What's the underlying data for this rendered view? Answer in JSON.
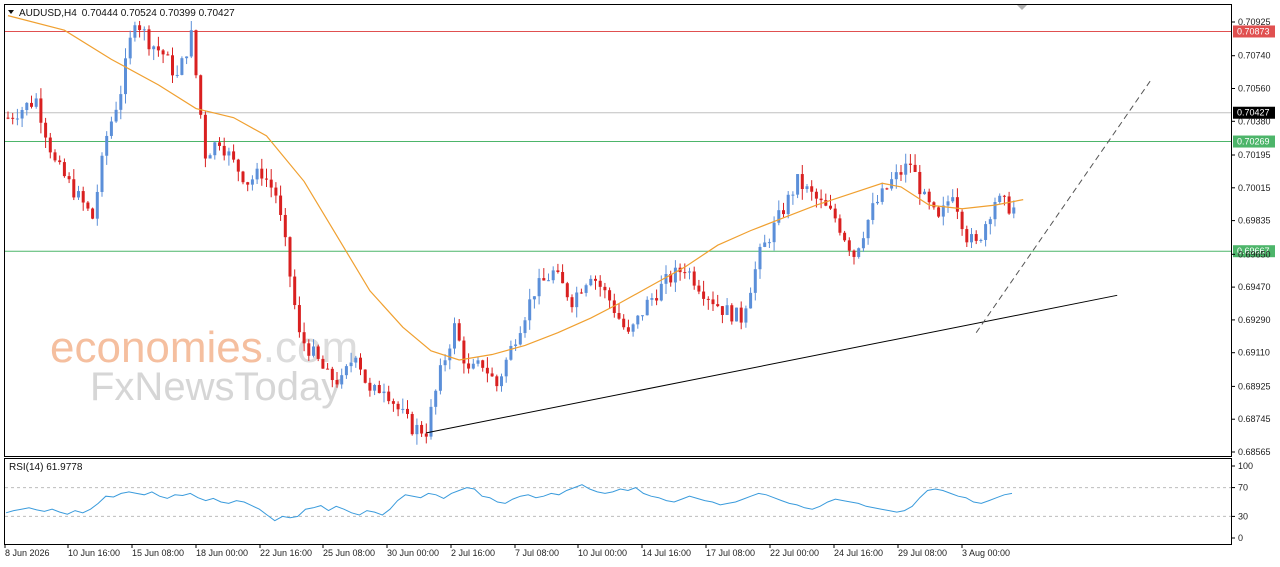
{
  "chart_data": {
    "type": "candlestick",
    "symbol": "AUDUSD,H4",
    "ohlc_header": "0.70444 0.70524 0.70399 0.70427",
    "last_close": 0.70427,
    "colors": {
      "bull": "#5b8fd9",
      "bear": "#d92020",
      "ma": "#f0a030",
      "rsi": "#3a9bdc",
      "resistance": "#e05050",
      "support": "#4db56a",
      "trend": "#000000"
    },
    "price_axis": {
      "min": 0.68565,
      "max": 0.71,
      "ticks": [
        "0.70925",
        "0.70740",
        "0.70560",
        "0.70380",
        "0.70195",
        "0.70015",
        "0.69835",
        "0.69650",
        "0.69470",
        "0.69290",
        "0.69110",
        "0.68925",
        "0.68745",
        "0.68565"
      ]
    },
    "levels": [
      {
        "name": "resistance",
        "value": 0.70873,
        "label": "0.70873"
      },
      {
        "name": "support-upper",
        "value": 0.70269,
        "label": "0.70269"
      },
      {
        "name": "support-lower",
        "value": 0.69667,
        "label": "0.69667"
      }
    ],
    "current_price_label": "0.70427",
    "x_axis": {
      "labels": [
        "8 Jun 2026",
        "10 Jun 16:00",
        "15 Jun 08:00",
        "18 Jun 00:00",
        "22 Jun 16:00",
        "25 Jun 08:00",
        "30 Jun 00:00",
        "2 Jul 16:00",
        "7 Jul 08:00",
        "10 Jul 00:00",
        "14 Jul 16:00",
        "17 Jul 08:00",
        "22 Jul 00:00",
        "24 Jul 16:00",
        "29 Jul 08:00",
        "3 Aug 00:00"
      ]
    },
    "ma_path": [
      [
        0,
        0.7096
      ],
      [
        12,
        0.7088
      ],
      [
        22,
        0.7072
      ],
      [
        32,
        0.7058
      ],
      [
        40,
        0.7045
      ],
      [
        48,
        0.704
      ],
      [
        55,
        0.703
      ],
      [
        63,
        0.7005
      ],
      [
        70,
        0.6975
      ],
      [
        77,
        0.6945
      ],
      [
        84,
        0.6925
      ],
      [
        90,
        0.6912
      ],
      [
        96,
        0.6907
      ],
      [
        103,
        0.691
      ],
      [
        110,
        0.6915
      ],
      [
        117,
        0.6922
      ],
      [
        124,
        0.693
      ],
      [
        130,
        0.6938
      ],
      [
        137,
        0.6948
      ],
      [
        144,
        0.6958
      ],
      [
        151,
        0.697
      ],
      [
        158,
        0.6978
      ],
      [
        165,
        0.6985
      ],
      [
        172,
        0.6992
      ],
      [
        179,
        0.6998
      ],
      [
        186,
        0.7004
      ],
      [
        190,
        0.7002
      ],
      [
        196,
        0.6992
      ],
      [
        203,
        0.699
      ],
      [
        210,
        0.6992
      ],
      [
        216,
        0.6995
      ]
    ],
    "trendlines": [
      {
        "name": "main-trendline",
        "style": "solid",
        "from": [
          89,
          0.6867
        ],
        "to": [
          236,
          0.69425
        ]
      },
      {
        "name": "steep-trendline",
        "style": "dashed",
        "from": [
          206,
          0.6922
        ],
        "to": [
          243,
          0.706
        ]
      }
    ],
    "rsi": {
      "label": "RSI(14) 61.9778",
      "value": 61.9778,
      "levels": [
        70,
        30
      ],
      "ticks": [
        "100",
        "70",
        "30",
        "0"
      ],
      "series": [
        35,
        38,
        40,
        42,
        39,
        37,
        40,
        36,
        33,
        38,
        35,
        40,
        48,
        58,
        57,
        62,
        64,
        62,
        60,
        64,
        58,
        55,
        60,
        59,
        62,
        56,
        52,
        55,
        50,
        48,
        52,
        50,
        45,
        40,
        32,
        24,
        30,
        28,
        30,
        40,
        42,
        45,
        38,
        44,
        40,
        35,
        32,
        38,
        36,
        32,
        40,
        52,
        60,
        58,
        56,
        62,
        60,
        55,
        62,
        66,
        70,
        68,
        58,
        56,
        50,
        48,
        54,
        58,
        60,
        56,
        58,
        62,
        60,
        66,
        70,
        74,
        68,
        64,
        62,
        64,
        68,
        66,
        70,
        62,
        58,
        56,
        52,
        50,
        54,
        58,
        55,
        52,
        50,
        46,
        48,
        50,
        54,
        58,
        62,
        60,
        56,
        52,
        48,
        46,
        42,
        40,
        44,
        50,
        54,
        52,
        50,
        48,
        44,
        42,
        40,
        38,
        36,
        38,
        44,
        56,
        66,
        68,
        66,
        62,
        58,
        56,
        50,
        48,
        52,
        56,
        60,
        62
      ]
    }
  },
  "watermark": {
    "brand": "economies",
    "brand_suffix": ".com",
    "sub": "FxNewsToday"
  }
}
